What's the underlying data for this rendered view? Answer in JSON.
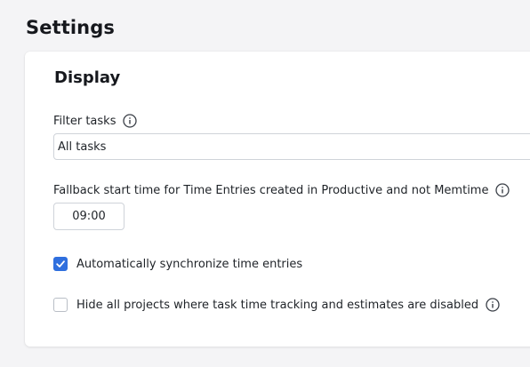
{
  "page": {
    "title": "Settings"
  },
  "display_section": {
    "title": "Display",
    "filter_tasks": {
      "label": "Filter tasks",
      "value": "All tasks"
    },
    "fallback_start_time": {
      "label": "Fallback start time for Time Entries created in Productive and not Memtime",
      "value": "09:00"
    },
    "auto_sync": {
      "label": "Automatically synchronize time entries",
      "checked": true
    },
    "hide_projects": {
      "label": "Hide all projects where task time tracking and estimates are disabled",
      "checked": false
    }
  },
  "colors": {
    "accent": "#2f6fde",
    "background": "#f4f4f6",
    "card": "#ffffff"
  },
  "icons": {
    "info": "info-icon",
    "check": "checkmark-icon"
  }
}
